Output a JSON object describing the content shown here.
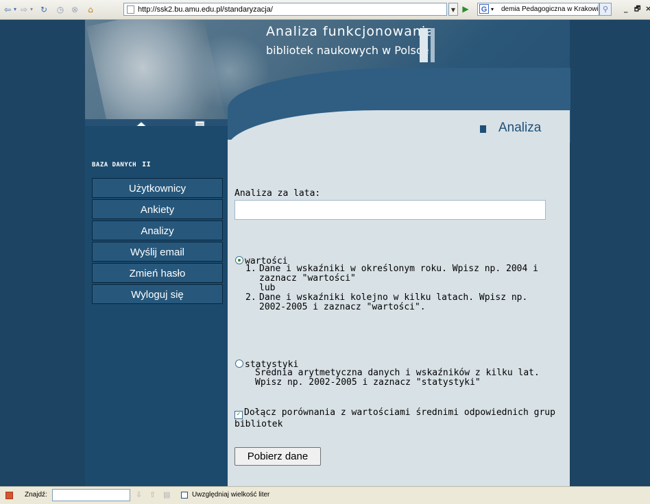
{
  "browser": {
    "url": "http://ssk2.bu.amu.edu.pl/standaryzacja/",
    "search_text": "demia Pedagogiczna w Krakowie",
    "back_icon": "back-arrow-icon",
    "forward_icon": "forward-arrow-icon",
    "reload_icon": "reload-icon",
    "stop_icon": "stop-icon",
    "home_icon": "home-icon",
    "go_icon": "go-arrow-icon",
    "search_engine_icon": "google-icon",
    "search_button_icon": "magnifier-icon",
    "minimize": "_",
    "restore": "🗗"
  },
  "banner": {
    "title_line1": "Analiza funkcjonowania",
    "title_line2": "bibliotek naukowych w Polsce"
  },
  "sidebar": {
    "section_title": "BAZA DANYCH",
    "section_mark": "II",
    "items": [
      {
        "label": "Użytkownicy"
      },
      {
        "label": "Ankiety"
      },
      {
        "label": "Analizy"
      },
      {
        "label": "Wyślij email"
      },
      {
        "label": "Zmień hasło"
      },
      {
        "label": "Wyloguj się"
      }
    ]
  },
  "main": {
    "heading": "Analiza",
    "years_label": "Analiza za lata:",
    "years_value": "",
    "option_values": {
      "label": "wartości",
      "selected": true
    },
    "list": [
      {
        "num": "1.",
        "text": "Dane i wskaźniki w określonym roku. Wpisz np. 2004 i zaznacz \"wartości\"",
        "extra": "lub"
      },
      {
        "num": "2.",
        "text": "Dane i wskaźniki kolejno w kilku latach. Wpisz np. 2002-2005 i zaznacz \"wartości\".",
        "extra": ""
      }
    ],
    "option_stats": {
      "label": "statystyki",
      "selected": false
    },
    "stats_desc": "Średnia arytmetyczna danych i wskaźników z kilku lat. Wpisz np. 2002-2005 i zaznacz \"statystyki\"",
    "compare_checkbox": {
      "label": "Dołącz porównania z wartościami średnimi odpowiednich grup bibliotek",
      "checked": true
    },
    "submit_label": "Pobierz dane"
  },
  "findbar": {
    "label": "Znajdź:",
    "value": "",
    "match_case_label": "Uwzględniaj wielkość liter"
  },
  "colors": {
    "page_bg": "#1d4563",
    "sidebar": "#1c4a6c",
    "content_bg": "#d8e1e6",
    "heading": "#1d4f78"
  }
}
